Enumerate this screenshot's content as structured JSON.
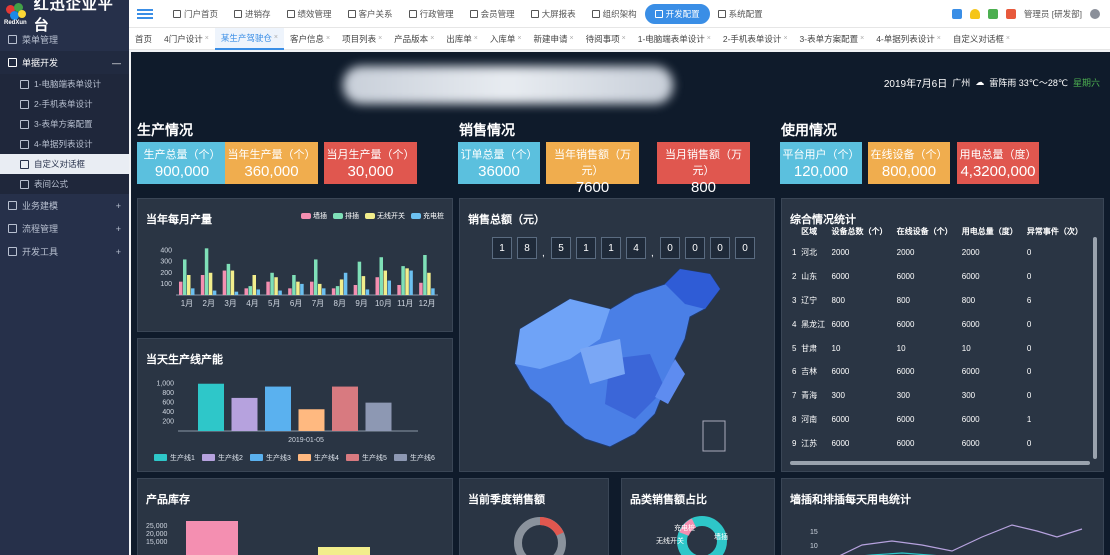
{
  "app": {
    "title": "红迅企业平台",
    "logo_sub": "RedXun"
  },
  "sidebar": {
    "items": [
      {
        "label": "菜单管理",
        "icon": "grid-icon",
        "open": false,
        "toggle": ""
      },
      {
        "label": "单据开发",
        "icon": "doc-icon",
        "open": true,
        "toggle": "—",
        "children": [
          {
            "label": "1-电脑端表单设计",
            "active": false
          },
          {
            "label": "2-手机表单设计",
            "active": false
          },
          {
            "label": "3-表单方案配置",
            "active": false
          },
          {
            "label": "4-单据列表设计",
            "active": false
          },
          {
            "label": "自定义对话框",
            "active": true
          },
          {
            "label": "表间公式",
            "active": false
          }
        ]
      },
      {
        "label": "业务建模",
        "icon": "globe-icon",
        "open": false,
        "toggle": "+"
      },
      {
        "label": "流程管理",
        "icon": "flow-icon",
        "open": false,
        "toggle": "+"
      },
      {
        "label": "开发工具",
        "icon": "wrench-icon",
        "open": false,
        "toggle": "+"
      }
    ]
  },
  "topnav": {
    "items": [
      "门户首页",
      "进销存",
      "绩效管理",
      "客户关系",
      "行政管理",
      "会员管理",
      "大屏报表",
      "组织架构",
      "开发配置",
      "系统配置"
    ],
    "active": "开发配置",
    "user": "管理员 [研发部]"
  },
  "tabs": [
    "首页",
    "4门户设计",
    "某生产驾驶仓",
    "客户信息",
    "项目列表",
    "产品版本",
    "出库单",
    "入库单",
    "新建申请",
    "待阅事项",
    "1-电脑端表单设计",
    "2-手机表单设计",
    "3-表单方案配置",
    "4-单据列表设计",
    "自定义对话框"
  ],
  "active_tab": "某生产驾驶仓",
  "dash": {
    "date": "2019年7月6日",
    "city": "广州",
    "weather": "雷阵雨 33℃～28℃",
    "weekday": "星期六",
    "sections": {
      "production": "生产情况",
      "sales": "销售情况",
      "usage": "使用情况"
    },
    "kpis": [
      {
        "label": "生产总量（个）",
        "value": "900,000",
        "color": "#5bc0de"
      },
      {
        "label": "当年生产量（个）",
        "value": "360,000",
        "color": "#f0ad4e"
      },
      {
        "label": "当月生产量（个）",
        "value": "30,000",
        "color": "#e0574f"
      },
      {
        "label": "订单总量（个）",
        "value": "36000",
        "color": "#5bc0de"
      },
      {
        "label": "当年销售额（万元）",
        "value": "7600",
        "color": "#f0ad4e"
      },
      {
        "label": "当月销售额（万元）",
        "value": "800",
        "color": "#e0574f"
      },
      {
        "label": "平台用户（个）",
        "value": "120,000",
        "color": "#5bc0de"
      },
      {
        "label": "在线设备（个）",
        "value": "800,000",
        "color": "#f0ad4e"
      },
      {
        "label": "用电总量（度）",
        "value": "4,3200,000",
        "color": "#e0574f"
      }
    ],
    "panels": {
      "monthly": "当年每月产量",
      "lines": "当天生产线产能",
      "sales_total": "销售总额（元）",
      "summary": "综合情况统计",
      "stock": "产品库存",
      "quarter": "当前季度销售额",
      "category": "品类销售额占比",
      "power": "墙插和排插每天用电统计"
    },
    "sales_digits": [
      "1",
      "8",
      ",",
      "5",
      "1",
      "1",
      "4",
      ",",
      "0",
      "0",
      "0",
      "0"
    ],
    "summary_table": {
      "headers": [
        "",
        "区域",
        "设备总数（个）",
        "在线设备（个）",
        "用电总量（度）",
        "异常事件（次）"
      ],
      "rows": [
        [
          "1",
          "河北",
          "2000",
          "2000",
          "2000",
          "0"
        ],
        [
          "2",
          "山东",
          "6000",
          "6000",
          "6000",
          "0"
        ],
        [
          "3",
          "辽宁",
          "800",
          "800",
          "800",
          "6"
        ],
        [
          "4",
          "黑龙江",
          "6000",
          "6000",
          "6000",
          "0"
        ],
        [
          "5",
          "甘肃",
          "10",
          "10",
          "10",
          "0"
        ],
        [
          "6",
          "吉林",
          "6000",
          "6000",
          "6000",
          "0"
        ],
        [
          "7",
          "青海",
          "300",
          "300",
          "300",
          "0"
        ],
        [
          "8",
          "河南",
          "6000",
          "6000",
          "6000",
          "1"
        ],
        [
          "9",
          "江苏",
          "6000",
          "6000",
          "6000",
          "0"
        ]
      ]
    },
    "category_labels": [
      "充电桩",
      "无线开关",
      "墙插"
    ],
    "stock_ticks": [
      "25,000",
      "20,000",
      "15,000"
    ],
    "power_ticks": [
      "15",
      "10"
    ]
  },
  "chart_data": [
    {
      "type": "bar",
      "title": "当年每月产量",
      "categories": [
        "1月",
        "2月",
        "3月",
        "4月",
        "5月",
        "6月",
        "7月",
        "8月",
        "9月",
        "10月",
        "11月",
        "12月"
      ],
      "series": [
        {
          "name": "墙插",
          "color": "#f48fb1",
          "values": [
            120,
            180,
            220,
            60,
            120,
            60,
            120,
            60,
            90,
            160,
            90,
            110
          ]
        },
        {
          "name": "排插",
          "color": "#7fe0b8",
          "values": [
            320,
            420,
            280,
            80,
            200,
            180,
            320,
            80,
            300,
            340,
            260,
            360
          ]
        },
        {
          "name": "无线开关",
          "color": "#f2ee8c",
          "values": [
            180,
            200,
            220,
            180,
            160,
            120,
            100,
            140,
            170,
            220,
            240,
            200
          ]
        },
        {
          "name": "充电桩",
          "color": "#6cc0f0",
          "values": [
            60,
            40,
            30,
            50,
            40,
            100,
            60,
            200,
            50,
            130,
            220,
            60
          ]
        }
      ],
      "yticks": [
        100,
        200,
        300,
        400
      ],
      "ylim": [
        0,
        450
      ]
    },
    {
      "type": "bar",
      "title": "当天生产线产能",
      "categories": [
        "2019-01-05"
      ],
      "series": [
        {
          "name": "生产线1",
          "color": "#2ec7c9",
          "values": [
            1000
          ]
        },
        {
          "name": "生产线2",
          "color": "#b6a2de",
          "values": [
            700
          ]
        },
        {
          "name": "生产线3",
          "color": "#5ab1ef",
          "values": [
            940
          ]
        },
        {
          "name": "生产线4",
          "color": "#ffb980",
          "values": [
            460
          ]
        },
        {
          "name": "生产线5",
          "color": "#d87a80",
          "values": [
            940
          ]
        },
        {
          "name": "生产线6",
          "color": "#8d98b3",
          "values": [
            600
          ]
        }
      ],
      "yticks": [
        "200",
        "400",
        "600",
        "800",
        "1,000"
      ],
      "ylim": [
        0,
        1100
      ]
    }
  ]
}
